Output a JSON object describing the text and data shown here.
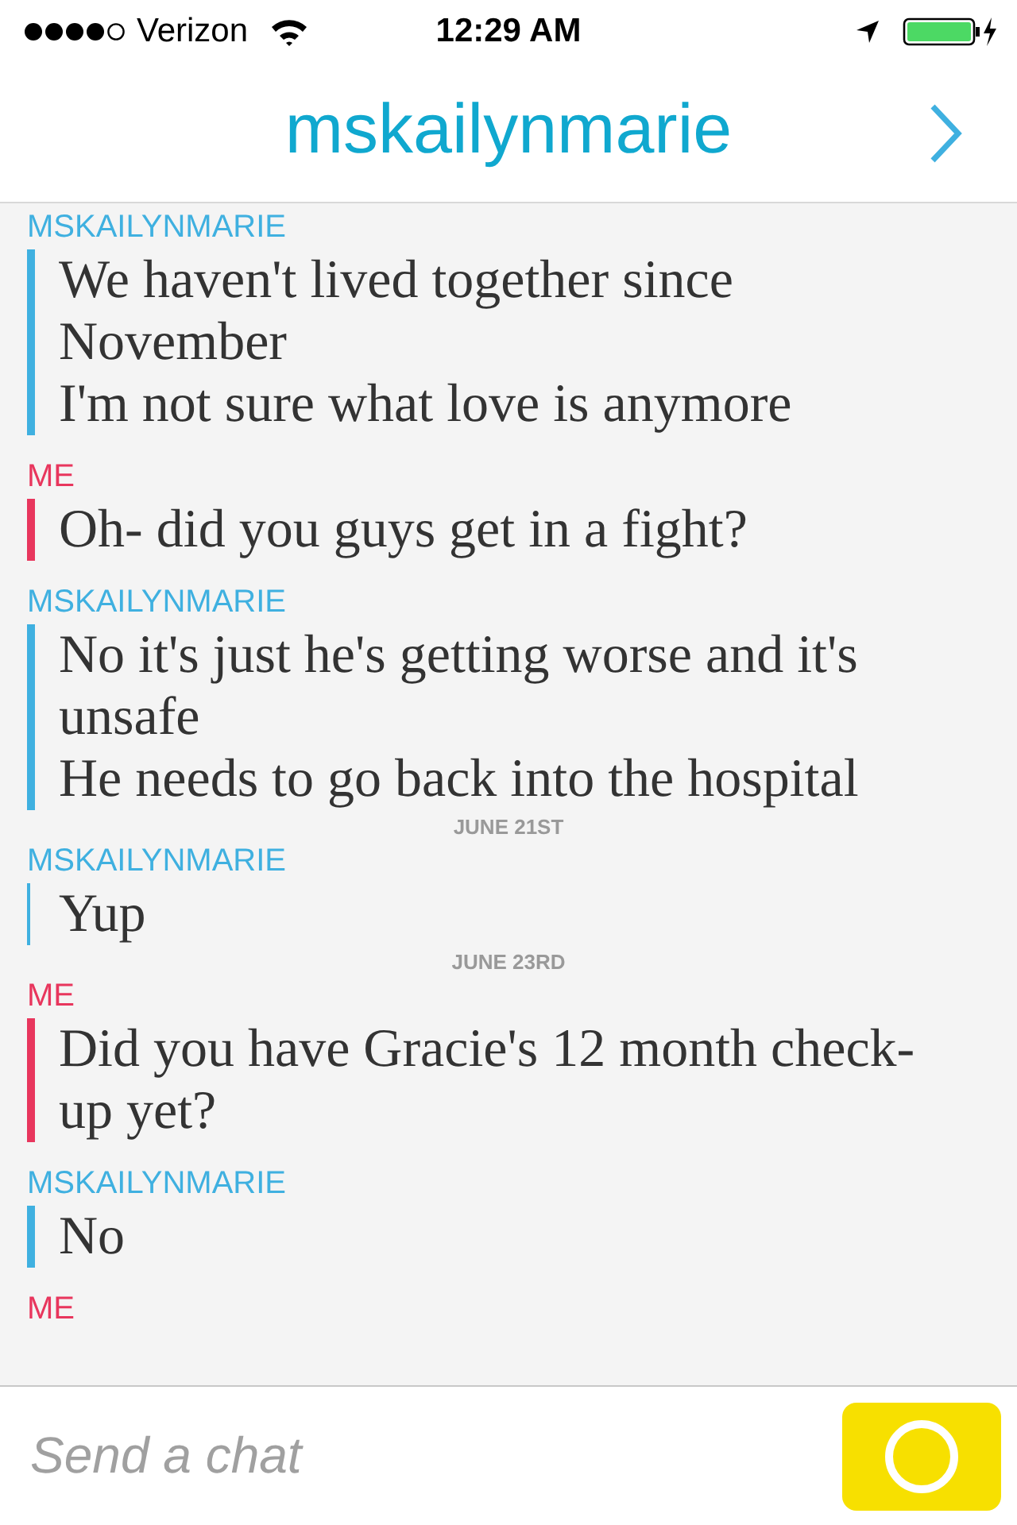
{
  "status_bar": {
    "carrier": "Verizon",
    "time": "12:29 AM"
  },
  "header": {
    "title": "mskailynmarie"
  },
  "chat": [
    {
      "kind": "group",
      "sender": "MSKAILYNMARIE",
      "color": "#3fb0e0",
      "messages": [
        {
          "lines": [
            "We haven't lived together since",
            "November"
          ],
          "saved": true
        },
        {
          "lines": [
            "I'm not sure what love is anymore"
          ],
          "saved": true
        }
      ]
    },
    {
      "kind": "group",
      "sender": "ME",
      "color": "#e8365d",
      "messages": [
        {
          "lines": [
            "Oh- did you guys get in a fight?"
          ],
          "saved": true
        }
      ]
    },
    {
      "kind": "group",
      "sender": "MSKAILYNMARIE",
      "color": "#3fb0e0",
      "messages": [
        {
          "lines": [
            "No it's just he's getting worse and it's",
            "unsafe"
          ],
          "saved": true
        },
        {
          "lines": [
            "He needs to go back into the hospital"
          ],
          "saved": true
        }
      ]
    },
    {
      "kind": "date",
      "text": "JUNE 21ST"
    },
    {
      "kind": "group",
      "sender": "MSKAILYNMARIE",
      "color": "#3fb0e0",
      "messages": [
        {
          "lines": [
            "Yup"
          ],
          "saved": false
        }
      ]
    },
    {
      "kind": "date",
      "text": "JUNE 23RD"
    },
    {
      "kind": "group",
      "sender": "ME",
      "color": "#e8365d",
      "messages": [
        {
          "lines": [
            "Did you have Gracie's 12 month check-",
            "up yet?"
          ],
          "saved": true
        }
      ]
    },
    {
      "kind": "group",
      "sender": "MSKAILYNMARIE",
      "color": "#3fb0e0",
      "messages": [
        {
          "lines": [
            "No"
          ],
          "saved": true
        }
      ]
    },
    {
      "kind": "group",
      "sender": "ME",
      "color": "#e8365d"
    }
  ],
  "composer": {
    "placeholder": "Send a chat"
  }
}
